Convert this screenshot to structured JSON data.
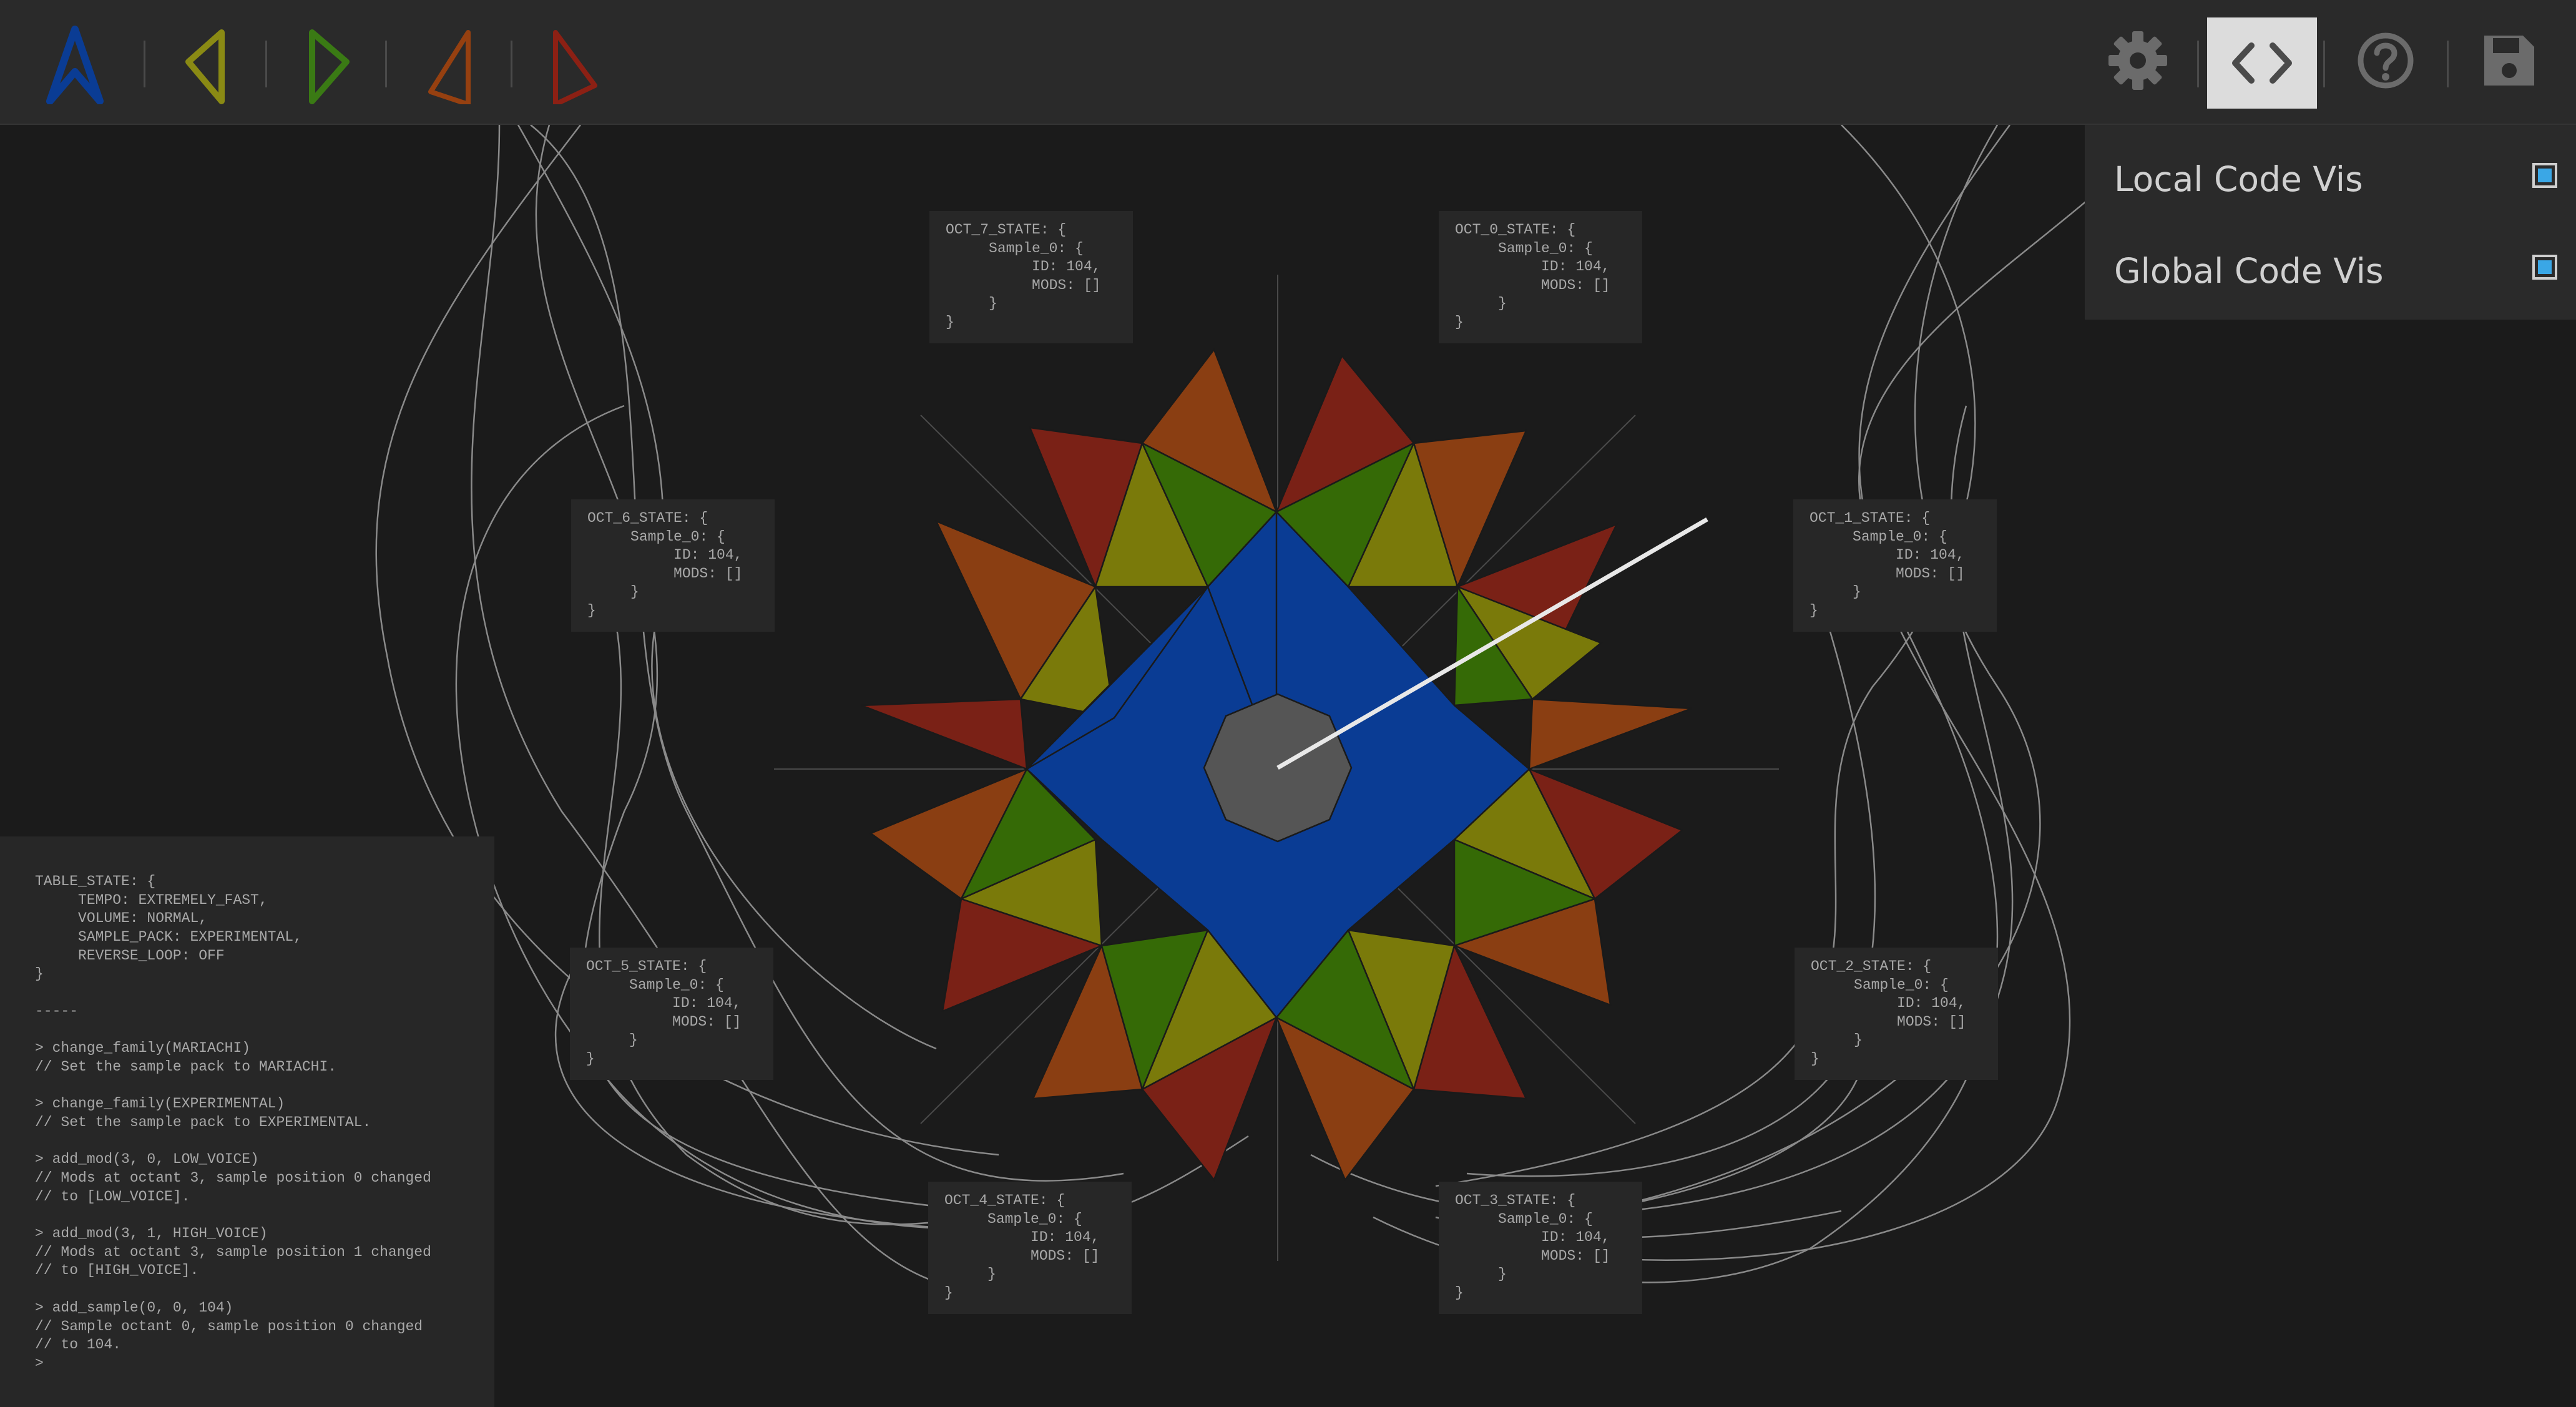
{
  "toolbar": {
    "instruments": [
      {
        "icon": "instrument-blue-icon",
        "color": "#0a3c94"
      },
      {
        "icon": "instrument-yellow-icon",
        "color": "#8a8a14"
      },
      {
        "icon": "instrument-green-icon",
        "color": "#3a7a14"
      },
      {
        "icon": "instrument-orange-icon",
        "color": "#964010"
      },
      {
        "icon": "instrument-red-icon",
        "color": "#8c2014"
      }
    ],
    "actions": [
      "gear-icon",
      "code-brackets-icon",
      "help-icon",
      "save-icon"
    ]
  },
  "visibility_menu": {
    "local_label": "Local Code Vis",
    "local_checked": true,
    "global_label": "Global Code Vis",
    "global_checked": true
  },
  "octants": {
    "oct7": "OCT_7_STATE: {\n     Sample_0: {\n          ID: 104,\n          MODS: []\n     }\n}",
    "oct0": "OCT_0_STATE: {\n     Sample_0: {\n          ID: 104,\n          MODS: []\n     }\n}",
    "oct6": "OCT_6_STATE: {\n     Sample_0: {\n          ID: 104,\n          MODS: []\n     }\n}",
    "oct1": "OCT_1_STATE: {\n     Sample_0: {\n          ID: 104,\n          MODS: []\n     }\n}",
    "oct5": "OCT_5_STATE: {\n     Sample_0: {\n          ID: 104,\n          MODS: []\n     }\n}",
    "oct2": "OCT_2_STATE: {\n     Sample_0: {\n          ID: 104,\n          MODS: []\n     }\n}",
    "oct4": "OCT_4_STATE: {\n     Sample_0: {\n          ID: 104,\n          MODS: []\n     }\n}",
    "oct3": "OCT_3_STATE: {\n     Sample_0: {\n          ID: 104,\n          MODS: []\n     }\n}"
  },
  "console": {
    "lines": [
      "TABLE_STATE: {",
      "     TEMPO: EXTREMELY_FAST,",
      "     VOLUME: NORMAL,",
      "     SAMPLE_PACK: EXPERIMENTAL,",
      "     REVERSE_LOOP: OFF",
      "}",
      "",
      "-----",
      "",
      "> change_family(MARIACHI)",
      "// Set the sample pack to MARIACHI.",
      "",
      "> change_family(EXPERIMENTAL)",
      "// Set the sample pack to EXPERIMENTAL.",
      "",
      "> add_mod(3, 0, LOW_VOICE)",
      "// Mods at octant 3, sample position 0 changed",
      "// to [LOW_VOICE].",
      "",
      "> add_mod(3, 1, HIGH_VOICE)",
      "// Mods at octant 3, sample position 1 changed",
      "// to [HIGH_VOICE].",
      "",
      "> add_sample(0, 0, 104)",
      "// Sample octant 0, sample position 0 changed",
      "// to 104.",
      ">"
    ]
  },
  "colors": {
    "blue": "#0a3c94",
    "yellow": "#7a7a0a",
    "green": "#356a06",
    "orange": "#8a3e12",
    "red": "#7a2116",
    "hub": "#555555",
    "checkbox": "#3aa7e6"
  }
}
